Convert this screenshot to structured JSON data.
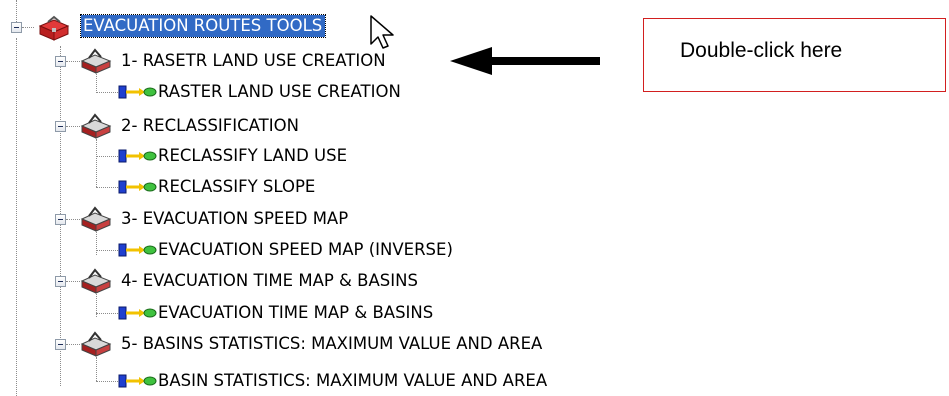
{
  "tree": {
    "root": {
      "label": "EVACUATION ROUTES TOOLS",
      "icon": "toolbox-icon"
    },
    "toolsets": [
      {
        "label": "1- RASETR LAND USE CREATION",
        "icon": "toolset-icon",
        "tools": [
          {
            "label": "RASTER LAND USE CREATION",
            "icon": "model-icon"
          }
        ]
      },
      {
        "label": "2- RECLASSIFICATION",
        "icon": "toolset-icon",
        "tools": [
          {
            "label": "RECLASSIFY LAND USE",
            "icon": "model-icon"
          },
          {
            "label": "RECLASSIFY SLOPE",
            "icon": "model-icon"
          }
        ]
      },
      {
        "label": "3- EVACUATION SPEED MAP",
        "icon": "toolset-icon",
        "tools": [
          {
            "label": "EVACUATION SPEED MAP (INVERSE)",
            "icon": "model-icon"
          }
        ]
      },
      {
        "label": "4- EVACUATION TIME MAP & BASINS",
        "icon": "toolset-icon",
        "tools": [
          {
            "label": "EVACUATION TIME MAP & BASINS",
            "icon": "model-icon"
          }
        ]
      },
      {
        "label": "5- BASINS STATISTICS: MAXIMUM VALUE AND AREA",
        "icon": "toolset-icon",
        "tools": [
          {
            "label": "BASIN STATISTICS: MAXIMUM VALUE AND AREA",
            "icon": "model-icon"
          }
        ]
      }
    ]
  },
  "annotation": {
    "callout_text": "Double-click here",
    "border_color": "#d21f1f"
  },
  "colors": {
    "selection": "#316ac5",
    "arrow": "#000000",
    "model_blue": "#1f3fcf",
    "model_green": "#3fc23f"
  }
}
